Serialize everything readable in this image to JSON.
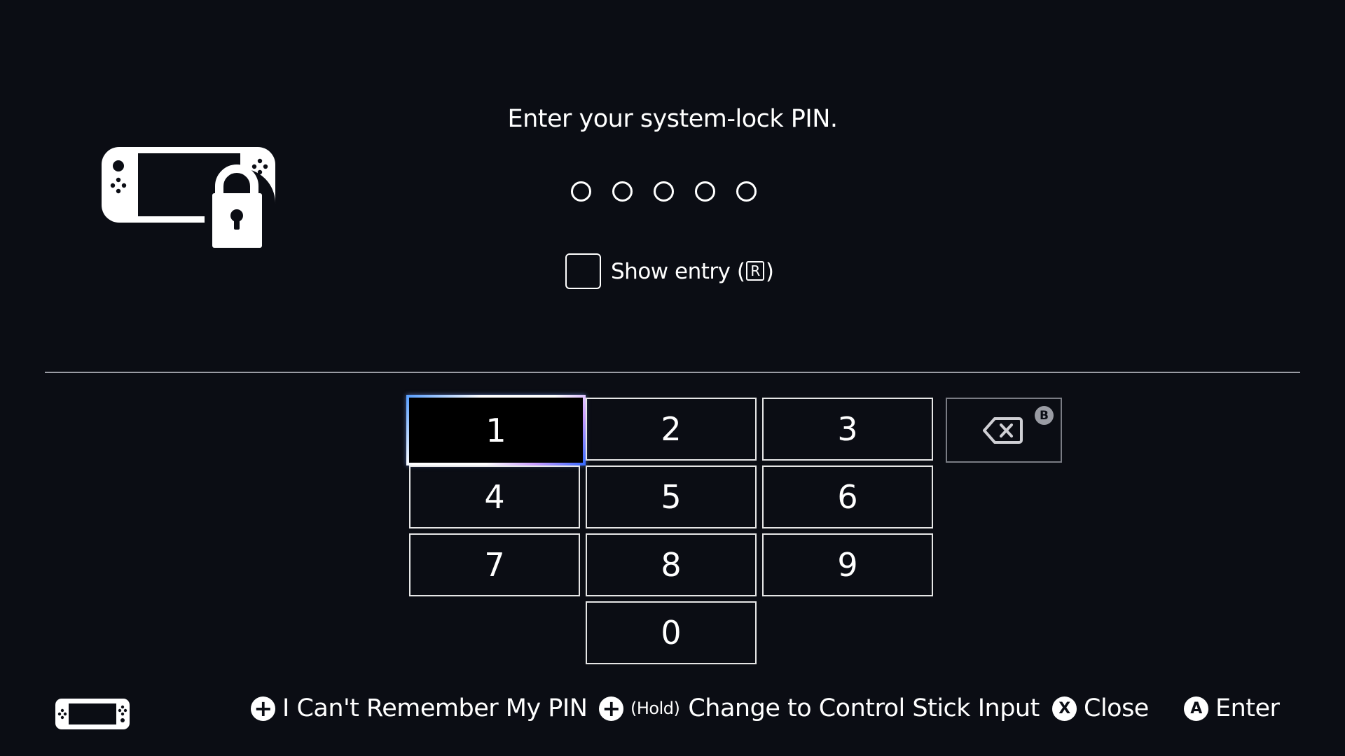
{
  "header": {
    "title": "Enter your system-lock PIN."
  },
  "pin": {
    "length": 5,
    "entered": 0
  },
  "show_entry": {
    "label_prefix": "Show entry (",
    "button": "R",
    "label_suffix": ")",
    "checked": false
  },
  "keypad": {
    "keys": [
      "1",
      "2",
      "3",
      "4",
      "5",
      "6",
      "7",
      "8",
      "9",
      "0"
    ],
    "selected": "1",
    "backspace_badge": "B"
  },
  "footer": {
    "forgot_pin": {
      "button": "+",
      "label": "I Can't Remember My PIN"
    },
    "stick_input": {
      "button": "+",
      "hold": "(Hold)",
      "label": "Change to Control Stick Input"
    },
    "close": {
      "button": "X",
      "label": "Close"
    },
    "enter": {
      "button": "A",
      "label": "Enter"
    }
  },
  "colors": {
    "background": "#0b0d14",
    "foreground": "#ffffff",
    "selection_glow": "#3b6cff"
  },
  "icons": [
    "console-lock-icon",
    "backspace-icon",
    "console-icon"
  ]
}
